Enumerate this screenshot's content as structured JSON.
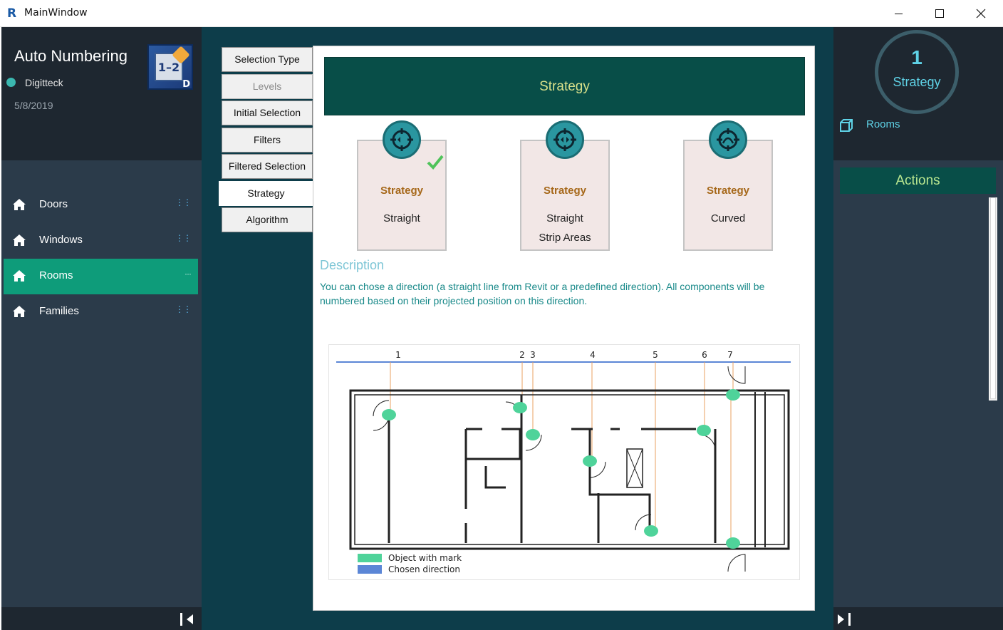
{
  "window": {
    "title": "MainWindow",
    "app_glyph": "R"
  },
  "header": {
    "app_name": "Auto Numbering",
    "company": "Digitteck",
    "date": "5/8/2019",
    "logo_text": "1–2",
    "logo_badge": "D"
  },
  "nav": {
    "items": [
      {
        "label": "Doors",
        "dots": "⋮⋮"
      },
      {
        "label": "Windows",
        "dots": "⋮⋮"
      },
      {
        "label": "Rooms",
        "dots": "···"
      },
      {
        "label": "Families",
        "dots": "⋮⋮"
      }
    ]
  },
  "tabs": [
    {
      "label": "Selection Type"
    },
    {
      "label": "Levels"
    },
    {
      "label": "Initial Selection"
    },
    {
      "label": "Filters"
    },
    {
      "label": "Filtered Selection"
    },
    {
      "label": "Strategy"
    },
    {
      "label": "Algorithm"
    }
  ],
  "content": {
    "banner": "Strategy",
    "cards": [
      {
        "title": "Strategy",
        "line1": "Straight",
        "line2": "",
        "selected": true
      },
      {
        "title": "Strategy",
        "line1": "Straight",
        "line2": "Strip Areas",
        "selected": false
      },
      {
        "title": "Strategy",
        "line1": "Curved",
        "line2": "",
        "selected": false
      }
    ],
    "description_title": "Description",
    "description_text": "You can chose a direction (a straight line from Revit or a predefined direction). All components will be numbered based on their projected position on this direction.",
    "diagram": {
      "numbers": [
        "1",
        "2",
        "3",
        "4",
        "5",
        "6",
        "7"
      ],
      "legend": [
        {
          "label": "Object with mark",
          "color": "#4fd39a"
        },
        {
          "label": "Chosen direction",
          "color": "#5b86d6"
        }
      ]
    }
  },
  "right": {
    "step_number": "1",
    "step_label": "Strategy",
    "category": "Rooms",
    "actions_label": "Actions"
  },
  "colors": {
    "sidebar_dark": "#1e2730",
    "sidebar_mid": "#2b3b4a",
    "accent_green": "#0e9c7a",
    "teal_bg": "#0d3d4a",
    "banner": "#084e48"
  },
  "icons": [
    "app-icon",
    "minimize-icon",
    "maximize-icon",
    "close-icon",
    "home-icon",
    "strategy-icon",
    "check-icon",
    "rooms-cube-icon",
    "collapse-left-icon",
    "collapse-right-icon"
  ]
}
